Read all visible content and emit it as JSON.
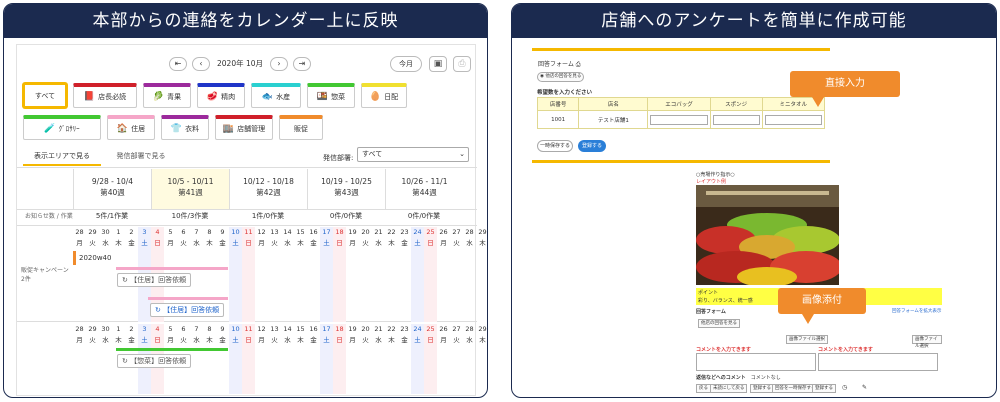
{
  "left_title": "本部からの連絡をカレンダー上に反映",
  "right_title": "店舗へのアンケートを簡単に作成可能",
  "calendar": {
    "month": "2020年 10月",
    "today": "今月",
    "categories": [
      {
        "label": "すべて",
        "color": "#f5b800",
        "icon": "none"
      },
      {
        "label": "店長必読",
        "color": "#d0202a",
        "icon": "book-icon"
      },
      {
        "label": "青果",
        "color": "#9c2a9c",
        "icon": "vegetable-icon"
      },
      {
        "label": "精肉",
        "color": "#2035c8",
        "icon": "meat-icon"
      },
      {
        "label": "水産",
        "color": "#2ad0d0",
        "icon": "fish-icon"
      },
      {
        "label": "惣菜",
        "color": "#42c832",
        "icon": "dish-icon"
      },
      {
        "label": "日配",
        "color": "#f0e030",
        "icon": "dairy-icon"
      },
      {
        "label": "ｸﾞﾛｻﾘｰ",
        "color": "#42c832",
        "icon": "grocery-icon"
      },
      {
        "label": "住居",
        "color": "#f5a6c8",
        "icon": "home-icon"
      },
      {
        "label": "衣料",
        "color": "#9c2a9c",
        "icon": "clothes-icon"
      },
      {
        "label": "店舗管理",
        "color": "#d0202a",
        "icon": "store-icon"
      },
      {
        "label": "販促",
        "color": "#f08b2c",
        "icon": "none"
      }
    ],
    "tab_area": "表示エリアで見る",
    "tab_dept": "発信部署で見る",
    "dept_label": "発信部署:",
    "dept_value": "すべて",
    "weeks": [
      {
        "range": "9/28 - 10/4",
        "num": "第40週",
        "count": "5件/1作業"
      },
      {
        "range": "10/5 - 10/11",
        "num": "第41週",
        "count": "10件/3作業"
      },
      {
        "range": "10/12 - 10/18",
        "num": "第42週",
        "count": "1件/0作業"
      },
      {
        "range": "10/19 - 10/25",
        "num": "第43週",
        "count": "0件/0作業"
      },
      {
        "range": "10/26 - 11/1",
        "num": "第44週",
        "count": "0件/0作業"
      }
    ],
    "notice_label": "お知らせ数 / 作業",
    "campaign_label": "販促キャンペーン",
    "campaign_count": "2件",
    "event_label": "2020w40",
    "req1": "【住居】回答依頼",
    "req2": "【住居】回答依頼",
    "req3": "【惣菜】回答依頼",
    "dates": [
      "28",
      "29",
      "30",
      "1",
      "2",
      "3",
      "4",
      "5",
      "6",
      "7",
      "8",
      "9",
      "10",
      "11",
      "12",
      "13",
      "14",
      "15",
      "16",
      "17",
      "18",
      "19",
      "20",
      "21",
      "22",
      "23",
      "24",
      "25",
      "26",
      "27",
      "28",
      "29",
      "30",
      "31",
      "1"
    ],
    "days": [
      "月",
      "火",
      "水",
      "木",
      "金",
      "土",
      "日",
      "月",
      "火",
      "水",
      "木",
      "金",
      "土",
      "日",
      "月",
      "火",
      "水",
      "木",
      "金",
      "土",
      "日",
      "月",
      "火",
      "水",
      "木",
      "金",
      "土",
      "日",
      "月",
      "火",
      "水",
      "木",
      "金",
      "土",
      "日"
    ]
  },
  "survey": {
    "form_title": "回答フォーム",
    "prev_btn": "他店の回答を見る",
    "question": "希望数を入力ください",
    "headers": [
      "店番号",
      "店名",
      "エコバッグ",
      "スポンジ",
      "ミニタオル"
    ],
    "row": [
      "1001",
      "テスト店舗1"
    ],
    "save_temp": "一時保存する",
    "submit": "登録する",
    "callout1": "直接入力",
    "callout2": "画像添付",
    "photo_title": "○売場作り指示○",
    "layout_example": "レイアウト例",
    "point_label": "ポイント",
    "point_text": "彩り、バランス、統一感",
    "answer_form": "回答フォーム",
    "other_btn": "他店の回答を見る",
    "file_btn": "画像ファイル選択",
    "comment_req": "コメントを入力てきます",
    "comment2": "コメントを入力てきます",
    "back_comment": "返信などへのコメント",
    "comment_none": "コメントなし",
    "enlarge": "回答フォームを拡大表示",
    "bottom_btns": [
      "戻る",
      "未読にして戻る",
      "登録する",
      "回答を一時保存する",
      "登録する"
    ]
  }
}
